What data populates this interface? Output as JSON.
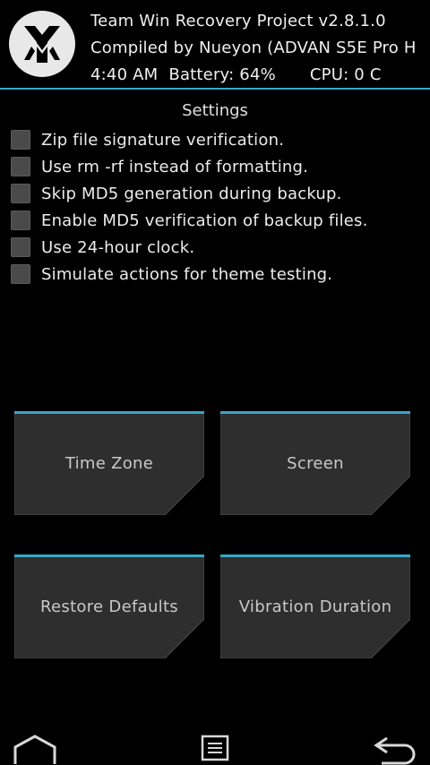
{
  "header": {
    "line1": "Team Win Recovery Project  v2.8.1.0",
    "line2": "Compiled by Nueyon (ADVAN S5E Pro H",
    "time": "4:40 AM",
    "battery": "Battery: 64%",
    "cpu": "CPU: 0 C"
  },
  "settings": {
    "title": "Settings",
    "options": [
      {
        "label": "Zip file signature verification.",
        "checked": false
      },
      {
        "label": "Use rm -rf instead of formatting.",
        "checked": false
      },
      {
        "label": "Skip MD5 generation during backup.",
        "checked": false
      },
      {
        "label": "Enable MD5 verification of backup files.",
        "checked": false
      },
      {
        "label": "Use 24-hour clock.",
        "checked": false
      },
      {
        "label": "Simulate actions for theme testing.",
        "checked": false
      }
    ]
  },
  "buttons": {
    "time_zone": "Time Zone",
    "screen": "Screen",
    "restore_defaults": "Restore Defaults",
    "vibration_duration": "Vibration Duration"
  },
  "nav": {
    "home_icon": "home-icon",
    "console_icon": "console-icon",
    "back_icon": "back-icon"
  },
  "colors": {
    "accent": "#3aa6c8",
    "button_face": "#2e2e2e",
    "checkbox": "#4a4a4a",
    "background": "#000000"
  }
}
